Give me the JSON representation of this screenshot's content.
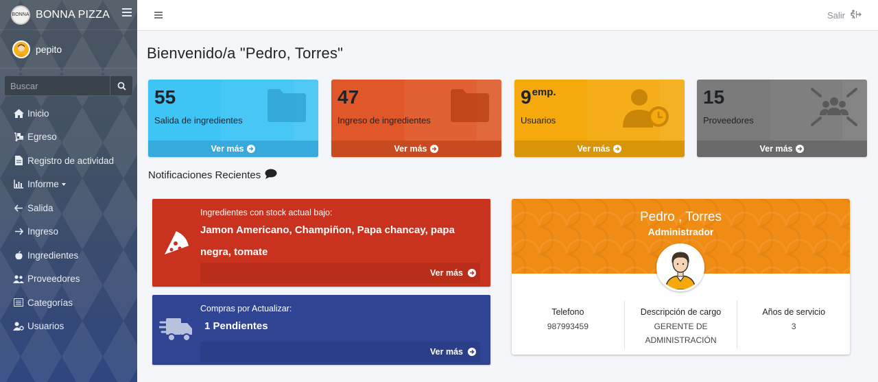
{
  "brand": {
    "name": "BONNA PIZZA",
    "logo_text": "BONNA"
  },
  "user": {
    "name": "pepito"
  },
  "search": {
    "placeholder": "Buscar"
  },
  "sidebar": {
    "items": [
      {
        "label": "Inicio",
        "icon": "home-icon"
      },
      {
        "label": "Egreso",
        "icon": "dolly-icon"
      },
      {
        "label": "Registro de actividad",
        "icon": "file-icon"
      },
      {
        "label": "Informe",
        "icon": "chart-icon"
      },
      {
        "label": "Salida",
        "icon": "arrow-left-icon"
      },
      {
        "label": "Ingreso",
        "icon": "arrow-right-icon"
      },
      {
        "label": "Ingredientes",
        "icon": "apple-icon"
      },
      {
        "label": "Proveedores",
        "icon": "users-icon"
      },
      {
        "label": "Categorías",
        "icon": "list-icon"
      },
      {
        "label": "Usuarios",
        "icon": "user-cog-icon"
      }
    ]
  },
  "header": {
    "logout_label": "Salir"
  },
  "welcome": "Bienvenido/a \"Pedro, Torres\"",
  "stats": [
    {
      "value": "55",
      "suffix": "",
      "label": "Salida de ingredientes",
      "link": "Ver más",
      "color": "#3ec4f5",
      "icon": "folder-icon"
    },
    {
      "value": "47",
      "suffix": "",
      "label": "Ingreso de ingredientes",
      "link": "Ver más",
      "color": "#e0582a",
      "icon": "folder-icon"
    },
    {
      "value": "9",
      "suffix": "emp.",
      "label": "Usuarios",
      "link": "Ver más",
      "color": "#f5a90d",
      "icon": "user-clock-icon"
    },
    {
      "value": "15",
      "suffix": "",
      "label": "Proveedores",
      "link": "Ver más",
      "color": "#7a7a7a",
      "icon": "network-users-icon"
    }
  ],
  "notifications": {
    "title": "Notificaciones Recientes",
    "items": [
      {
        "title": "Ingredientes con stock actual bajo:",
        "body": "Jamon Americano, Champiñon, Papa chancay, papa negra, tomate",
        "link": "Ver más",
        "color": "#c8321e",
        "icon": "pizza-icon"
      },
      {
        "title": "Compras por Actualizar:",
        "body": "1 Pendientes",
        "link": "Ver más",
        "color": "#2f4594",
        "icon": "truck-icon"
      }
    ]
  },
  "profile": {
    "name": "Pedro , Torres",
    "role": "Administrador",
    "stats": [
      {
        "header": "Telefono",
        "value": "987993459"
      },
      {
        "header": "Descripción de cargo",
        "value": "GERENTE DE ADMINISTRACIÓN"
      },
      {
        "header": "Años de servicio",
        "value": "3"
      }
    ]
  }
}
